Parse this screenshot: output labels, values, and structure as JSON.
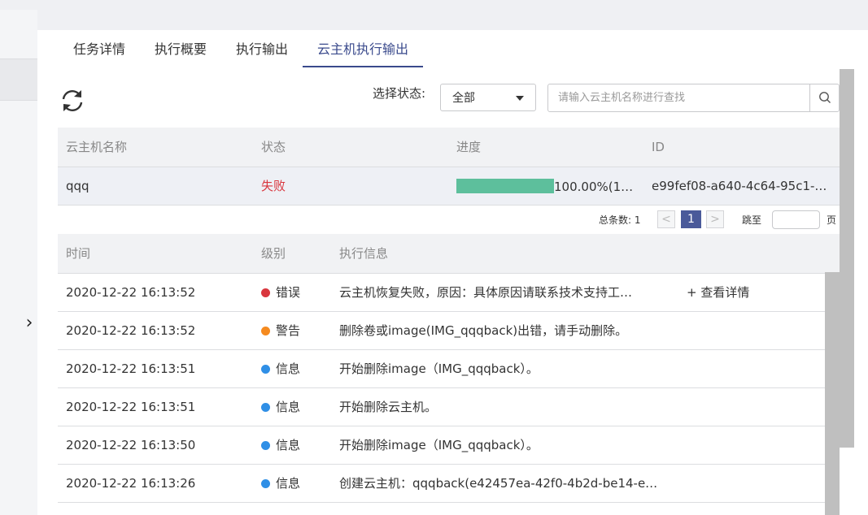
{
  "tabs": [
    {
      "label": "任务详情"
    },
    {
      "label": "执行概要"
    },
    {
      "label": "执行输出"
    },
    {
      "label": "云主机执行输出"
    }
  ],
  "active_tab": "云主机执行输出",
  "filter": {
    "status_label": "选择状态:",
    "status_value": "全部",
    "search_placeholder": "请输入云主机名称进行查找"
  },
  "vm_table": {
    "headers": {
      "name": "云主机名称",
      "status": "状态",
      "progress": "进度",
      "id": "ID"
    },
    "rows": [
      {
        "name": "qqq",
        "status": "失败",
        "progress_fraction": 1.0,
        "progress_text": "100.00%(1…",
        "id": "e99fef08-a640-4c64-95c1-…"
      }
    ]
  },
  "pagination": {
    "total_label": "总条数: 1",
    "current_page": "1",
    "prev": "<",
    "next": ">",
    "jump_label": "跳至",
    "page_unit": "页"
  },
  "log_table": {
    "headers": {
      "time": "时间",
      "level": "级别",
      "message": "执行信息"
    },
    "rows": [
      {
        "time": "2020-12-22 16:13:52",
        "level": "错误",
        "level_color": "#d9363e",
        "message": "云主机恢复失败，原因：具体原因请联系技术支持工…",
        "link": "+ 查看详情"
      },
      {
        "time": "2020-12-22 16:13:52",
        "level": "警告",
        "level_color": "#f58a1f",
        "message": "删除卷或image(IMG_qqqback)出错，请手动删除。",
        "link": ""
      },
      {
        "time": "2020-12-22 16:13:51",
        "level": "信息",
        "level_color": "#2f8fe6",
        "message": "开始删除image（IMG_qqqback）。",
        "link": ""
      },
      {
        "time": "2020-12-22 16:13:51",
        "level": "信息",
        "level_color": "#2f8fe6",
        "message": "开始删除云主机。",
        "link": ""
      },
      {
        "time": "2020-12-22 16:13:50",
        "level": "信息",
        "level_color": "#2f8fe6",
        "message": "开始删除image（IMG_qqqback）。",
        "link": ""
      },
      {
        "time": "2020-12-22 16:13:26",
        "level": "信息",
        "level_color": "#2f8fe6",
        "message": "创建云主机：qqqback(e42457ea-42f0-4b2d-be14-e…",
        "link": ""
      }
    ]
  },
  "side_toggle_icon": "chevron-right-icon"
}
